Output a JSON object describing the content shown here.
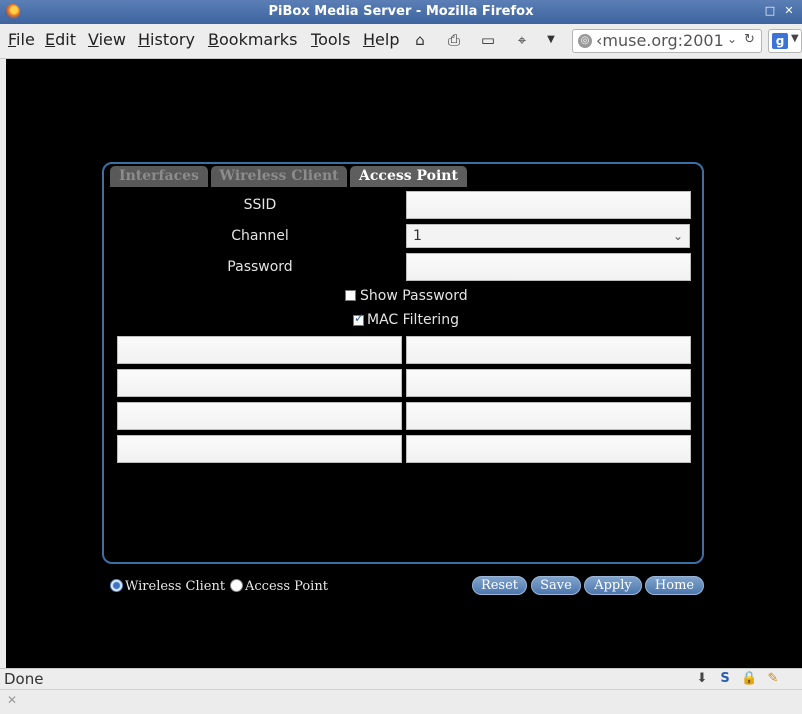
{
  "window": {
    "title": "PiBox Media Server - Mozilla Firefox"
  },
  "menu": [
    "File",
    "Edit",
    "View",
    "History",
    "Bookmarks",
    "Tools",
    "Help"
  ],
  "toolbar": {
    "url": "‹muse.org:2001"
  },
  "tabs": [
    "Interfaces",
    "Wireless Client",
    "Access Point"
  ],
  "form": {
    "ssid_label": "SSID",
    "channel_label": "Channel",
    "channel_value": "1",
    "password_label": "Password",
    "show_password_label": "Show Password",
    "show_password_checked": false,
    "mac_filtering_label": "MAC Filtering",
    "mac_filtering_checked": true
  },
  "mode": {
    "wireless_client_label": "Wireless Client",
    "access_point_label": "Access Point",
    "selected": "Wireless Client"
  },
  "buttons": {
    "reset": "Reset",
    "save": "Save",
    "apply": "Apply",
    "home": "Home"
  },
  "statusbar": {
    "status": "Done"
  },
  "colors": {
    "accent_border": "#3c6fa6",
    "button": "#5a84b8",
    "background": "#000000"
  }
}
